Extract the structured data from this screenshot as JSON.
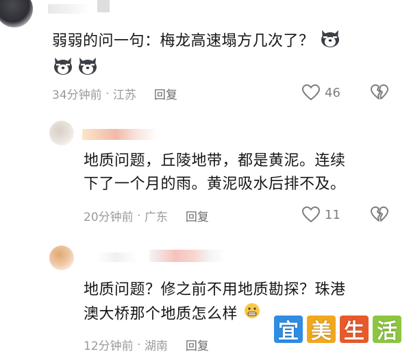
{
  "comments": [
    {
      "text": "弱弱的问一句：梅龙高速塌方几次了？",
      "time": "34分钟前",
      "location": "江苏",
      "reply_label": "回复",
      "likes": "46"
    },
    {
      "text_line1": "地质问题，丘陵地带，都是黄泥。连续",
      "text_line2": "下了一个月的雨。黄泥吸水后排不及。",
      "time": "20分钟前",
      "location": "广东",
      "reply_label": "回复",
      "likes": "11"
    },
    {
      "text_line1": "地质问题？修之前不用地质勘探？珠港",
      "text_line2": "澳大桥那个地质怎么样",
      "time": "12分钟前",
      "location": "湖南",
      "reply_label": "回复"
    }
  ],
  "separator": " · ",
  "watermark": {
    "chars": [
      "宜",
      "美",
      "生",
      "活"
    ],
    "colors": [
      "#2f8de4",
      "#f2a81d",
      "#e85a2b",
      "#8dc63f"
    ]
  },
  "icons": [
    "dog-emoji-icon",
    "heart-icon",
    "broken-heart-icon",
    "grimace-emoji-icon"
  ]
}
